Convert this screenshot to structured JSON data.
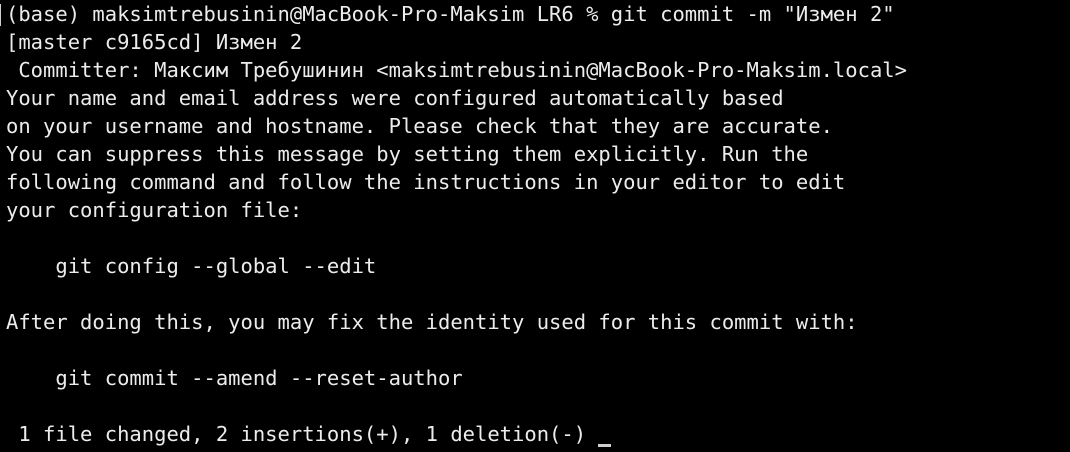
{
  "terminal": {
    "lines": [
      "(base) maksimtrebusinin@MacBook-Pro-Maksim LR6 % git commit -m \"Измен 2\"",
      "[master c9165cd] Измен 2",
      " Committer: Максим Требушинин <maksimtrebusinin@MacBook-Pro-Maksim.local>",
      "Your name and email address were configured automatically based",
      "on your username and hostname. Please check that they are accurate.",
      "You can suppress this message by setting them explicitly. Run the",
      "following command and follow the instructions in your editor to edit",
      "your configuration file:",
      "",
      "    git config --global --edit",
      "",
      "After doing this, you may fix the identity used for this commit with:",
      "",
      "    git commit --amend --reset-author",
      "",
      " 1 file changed, 2 insertions(+), 1 deletion(-)"
    ]
  }
}
